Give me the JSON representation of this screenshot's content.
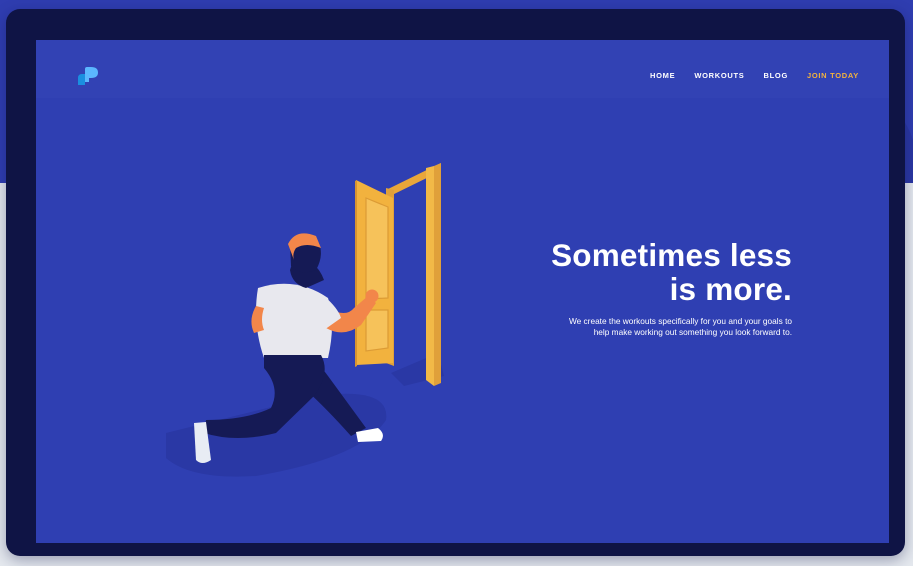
{
  "nav": {
    "items": [
      {
        "label": "HOME"
      },
      {
        "label": "WORKOUTS"
      },
      {
        "label": "BLOG"
      },
      {
        "label": "JOIN TODAY"
      }
    ]
  },
  "hero": {
    "headline_line1": "Sometimes less",
    "headline_line2": "is more.",
    "subtext_line1": "We create the workouts specifically for you and your goals to",
    "subtext_line2": "help make working out something you look forward to."
  },
  "colors": {
    "background_band": "#2f3db0",
    "device_frame": "#0f1445",
    "screen_background": "#2f3fb2",
    "cta": "#f2b23e",
    "door": "#f2b23e"
  },
  "icons": {
    "logo": "brand-logo-icon"
  }
}
